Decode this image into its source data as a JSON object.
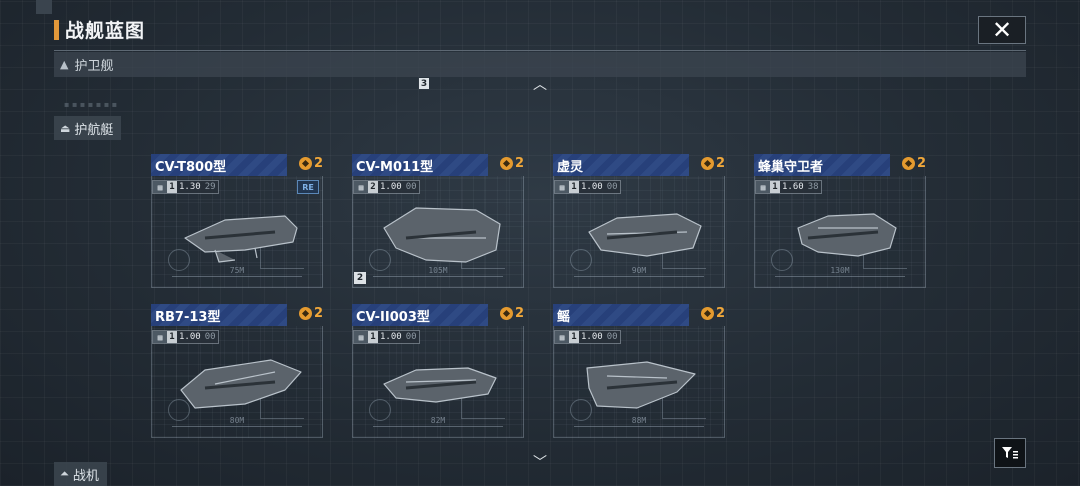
{
  "header": {
    "title": "战舰蓝图"
  },
  "category": {
    "current": "护卫舰",
    "tier_badge": "3"
  },
  "side_categories": [
    {
      "label": "护航艇"
    },
    {
      "label": "战机"
    }
  ],
  "cards": [
    {
      "name": "CV-T800型",
      "count": "2",
      "level": "1",
      "v1": "1.30",
      "v2": "29",
      "badge": "RE",
      "length": "75M",
      "tier": ""
    },
    {
      "name": "CV-M011型",
      "count": "2",
      "level": "2",
      "v1": "1.00",
      "v2": "00",
      "badge": "",
      "length": "105M",
      "tier": "2"
    },
    {
      "name": "虚灵",
      "count": "2",
      "level": "1",
      "v1": "1.00",
      "v2": "00",
      "badge": "",
      "length": "90M",
      "tier": ""
    },
    {
      "name": "蜂巢守卫者",
      "count": "2",
      "level": "1",
      "v1": "1.60",
      "v2": "38",
      "badge": "",
      "length": "130M",
      "tier": ""
    },
    {
      "name": "RB7-13型",
      "count": "2",
      "level": "1",
      "v1": "1.00",
      "v2": "00",
      "badge": "",
      "length": "80M",
      "tier": ""
    },
    {
      "name": "CV-II003型",
      "count": "2",
      "level": "1",
      "v1": "1.00",
      "v2": "00",
      "badge": "",
      "length": "82M",
      "tier": ""
    },
    {
      "name": "鳐",
      "count": "2",
      "level": "1",
      "v1": "1.00",
      "v2": "00",
      "badge": "",
      "length": "88M",
      "tier": ""
    }
  ],
  "colors": {
    "accent": "#e2983a",
    "name_plate": "#2f4a84",
    "count": "#f0a73a"
  },
  "icons": {
    "close": "close-icon",
    "filter": "filter-icon",
    "up": "chevron-up-icon",
    "down": "chevron-down-icon"
  }
}
